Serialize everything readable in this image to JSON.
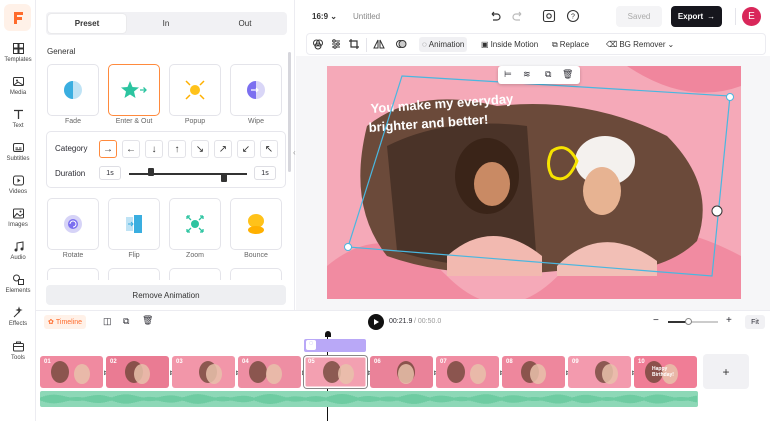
{
  "app": {
    "logo_letter": "F",
    "brand_color": "#ff6b2c"
  },
  "rail": [
    {
      "label": "Templates",
      "icon": "templates-icon"
    },
    {
      "label": "Media",
      "icon": "media-icon"
    },
    {
      "label": "Text",
      "icon": "text-icon"
    },
    {
      "label": "Subtitles",
      "icon": "subtitles-icon"
    },
    {
      "label": "Videos",
      "icon": "videos-icon"
    },
    {
      "label": "Images",
      "icon": "images-icon"
    },
    {
      "label": "Audio",
      "icon": "audio-icon"
    },
    {
      "label": "Elements",
      "icon": "elements-icon"
    },
    {
      "label": "Effects",
      "icon": "effects-icon"
    },
    {
      "label": "Tools",
      "icon": "tools-icon"
    }
  ],
  "panel": {
    "tabs": [
      "Preset",
      "In",
      "Out"
    ],
    "active_tab": "Preset",
    "section_title": "General",
    "row1": [
      "Fade",
      "Enter & Out",
      "Popup",
      "Wipe"
    ],
    "row2": [
      "Rotate",
      "Flip",
      "Zoom",
      "Bounce"
    ],
    "selected_effect": "Enter & Out",
    "category_label": "Category",
    "arrows": [
      "→",
      "←",
      "↓",
      "↑",
      "↘",
      "↗",
      "↙",
      "↖"
    ],
    "duration_label": "Duration",
    "duration_start": "1s",
    "duration_end": "1s",
    "remove_label": "Remove Animation"
  },
  "topbar": {
    "ratio": "16:9",
    "title": "Untitled",
    "saved_label": "Saved",
    "export_label": "Export",
    "avatar_letter": "E"
  },
  "toolbar": {
    "animation": "Animation",
    "inside_motion": "Inside Motion",
    "replace": "Replace",
    "bg_remover": "BG Remover"
  },
  "canvas": {
    "headline_line1": "You make my everyday",
    "headline_line2": "brighter and better!"
  },
  "timeline": {
    "tab_label": "Timeline",
    "current_time": "00:21.9",
    "total_time": "/ 00:50.0",
    "fit_label": "Fit",
    "clips": [
      "01",
      "02",
      "03",
      "04",
      "05",
      "06",
      "07",
      "08",
      "09",
      "10"
    ],
    "clip10_text": "Happy Birthday!"
  }
}
